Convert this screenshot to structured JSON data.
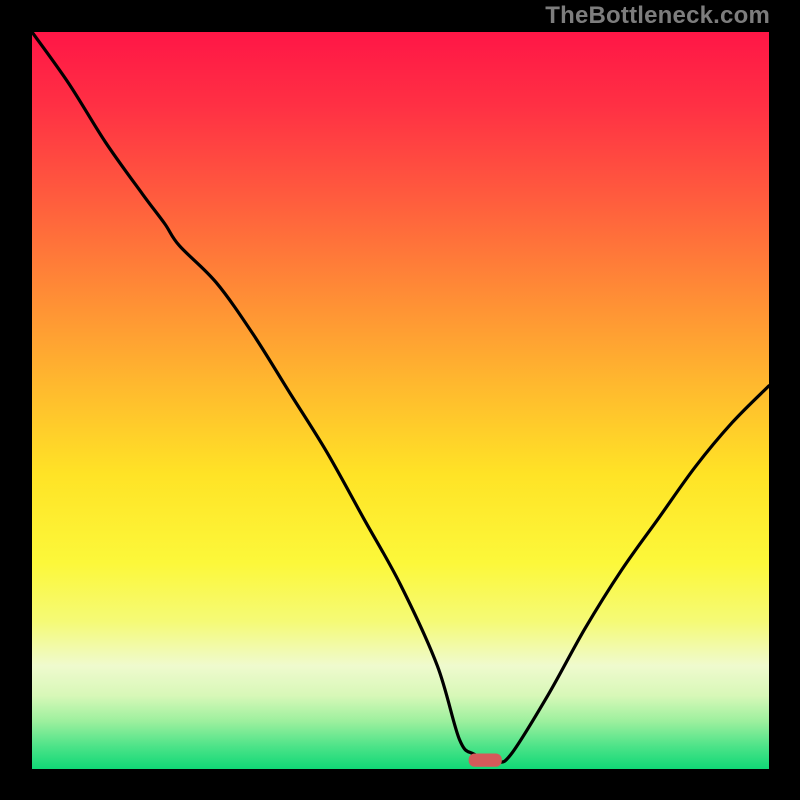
{
  "watermark": "TheBottleneck.com",
  "chart_data": {
    "type": "line",
    "title": "",
    "xlabel": "",
    "ylabel": "",
    "xlim": [
      0,
      100
    ],
    "ylim": [
      0,
      100
    ],
    "series": [
      {
        "name": "bottleneck-curve",
        "x": [
          0,
          5,
          10,
          15,
          18,
          20,
          25,
          30,
          35,
          40,
          45,
          50,
          55,
          58,
          60,
          63,
          65,
          70,
          75,
          80,
          85,
          90,
          95,
          100
        ],
        "values": [
          100,
          93,
          85,
          78,
          74,
          71,
          66,
          59,
          51,
          43,
          34,
          25,
          14,
          4,
          2,
          1,
          2,
          10,
          19,
          27,
          34,
          41,
          47,
          52
        ]
      }
    ],
    "marker": {
      "x": 61.5,
      "y": 1.2,
      "width": 4.5,
      "height": 1.8,
      "color": "#d55a5a"
    },
    "background_gradient": {
      "stops": [
        {
          "offset": 0.0,
          "color": "#ff1646"
        },
        {
          "offset": 0.1,
          "color": "#ff3044"
        },
        {
          "offset": 0.22,
          "color": "#ff5a3e"
        },
        {
          "offset": 0.35,
          "color": "#ff8a36"
        },
        {
          "offset": 0.48,
          "color": "#ffb92e"
        },
        {
          "offset": 0.6,
          "color": "#ffe326"
        },
        {
          "offset": 0.72,
          "color": "#fcf83a"
        },
        {
          "offset": 0.8,
          "color": "#f5fa76"
        },
        {
          "offset": 0.86,
          "color": "#efface"
        },
        {
          "offset": 0.9,
          "color": "#d8f8b8"
        },
        {
          "offset": 0.935,
          "color": "#9df09e"
        },
        {
          "offset": 0.97,
          "color": "#4be388"
        },
        {
          "offset": 1.0,
          "color": "#10d876"
        }
      ]
    }
  }
}
